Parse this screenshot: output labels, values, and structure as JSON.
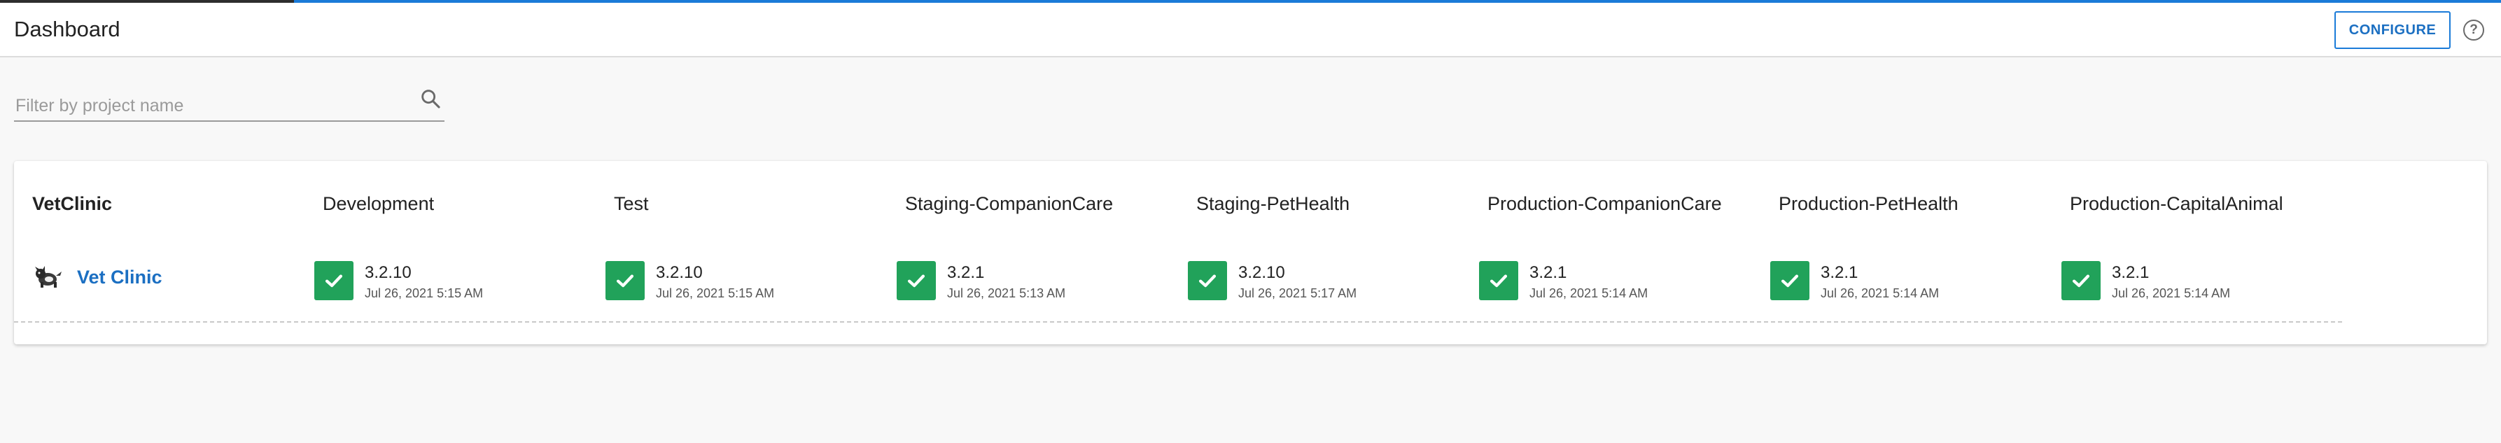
{
  "header": {
    "title": "Dashboard",
    "configure_label": "CONFIGURE",
    "help_icon": "help-circle-icon",
    "help_glyph": "?"
  },
  "filter": {
    "placeholder": "Filter by project name",
    "value": "",
    "icon": "search-icon"
  },
  "colors": {
    "accent": "#1b7bd8",
    "success": "#21a25a",
    "link": "#1b6fc2"
  },
  "project_group": {
    "name": "VetClinic",
    "environments": [
      "Development",
      "Test",
      "Staging-CompanionCare",
      "Staging-PetHealth",
      "Production-CompanionCare",
      "Production-PetHealth",
      "Production-CapitalAnimal"
    ],
    "projects": [
      {
        "name": "Vet Clinic",
        "logo_icon": "dog-logo-icon",
        "releases": [
          {
            "version": "3.2.10",
            "date": "Jul 26, 2021 5:15 AM",
            "status": "success"
          },
          {
            "version": "3.2.10",
            "date": "Jul 26, 2021 5:15 AM",
            "status": "success"
          },
          {
            "version": "3.2.1",
            "date": "Jul 26, 2021 5:13 AM",
            "status": "success"
          },
          {
            "version": "3.2.10",
            "date": "Jul 26, 2021 5:17 AM",
            "status": "success"
          },
          {
            "version": "3.2.1",
            "date": "Jul 26, 2021 5:14 AM",
            "status": "success"
          },
          {
            "version": "3.2.1",
            "date": "Jul 26, 2021 5:14 AM",
            "status": "success"
          },
          {
            "version": "3.2.1",
            "date": "Jul 26, 2021 5:14 AM",
            "status": "success"
          }
        ]
      }
    ]
  }
}
